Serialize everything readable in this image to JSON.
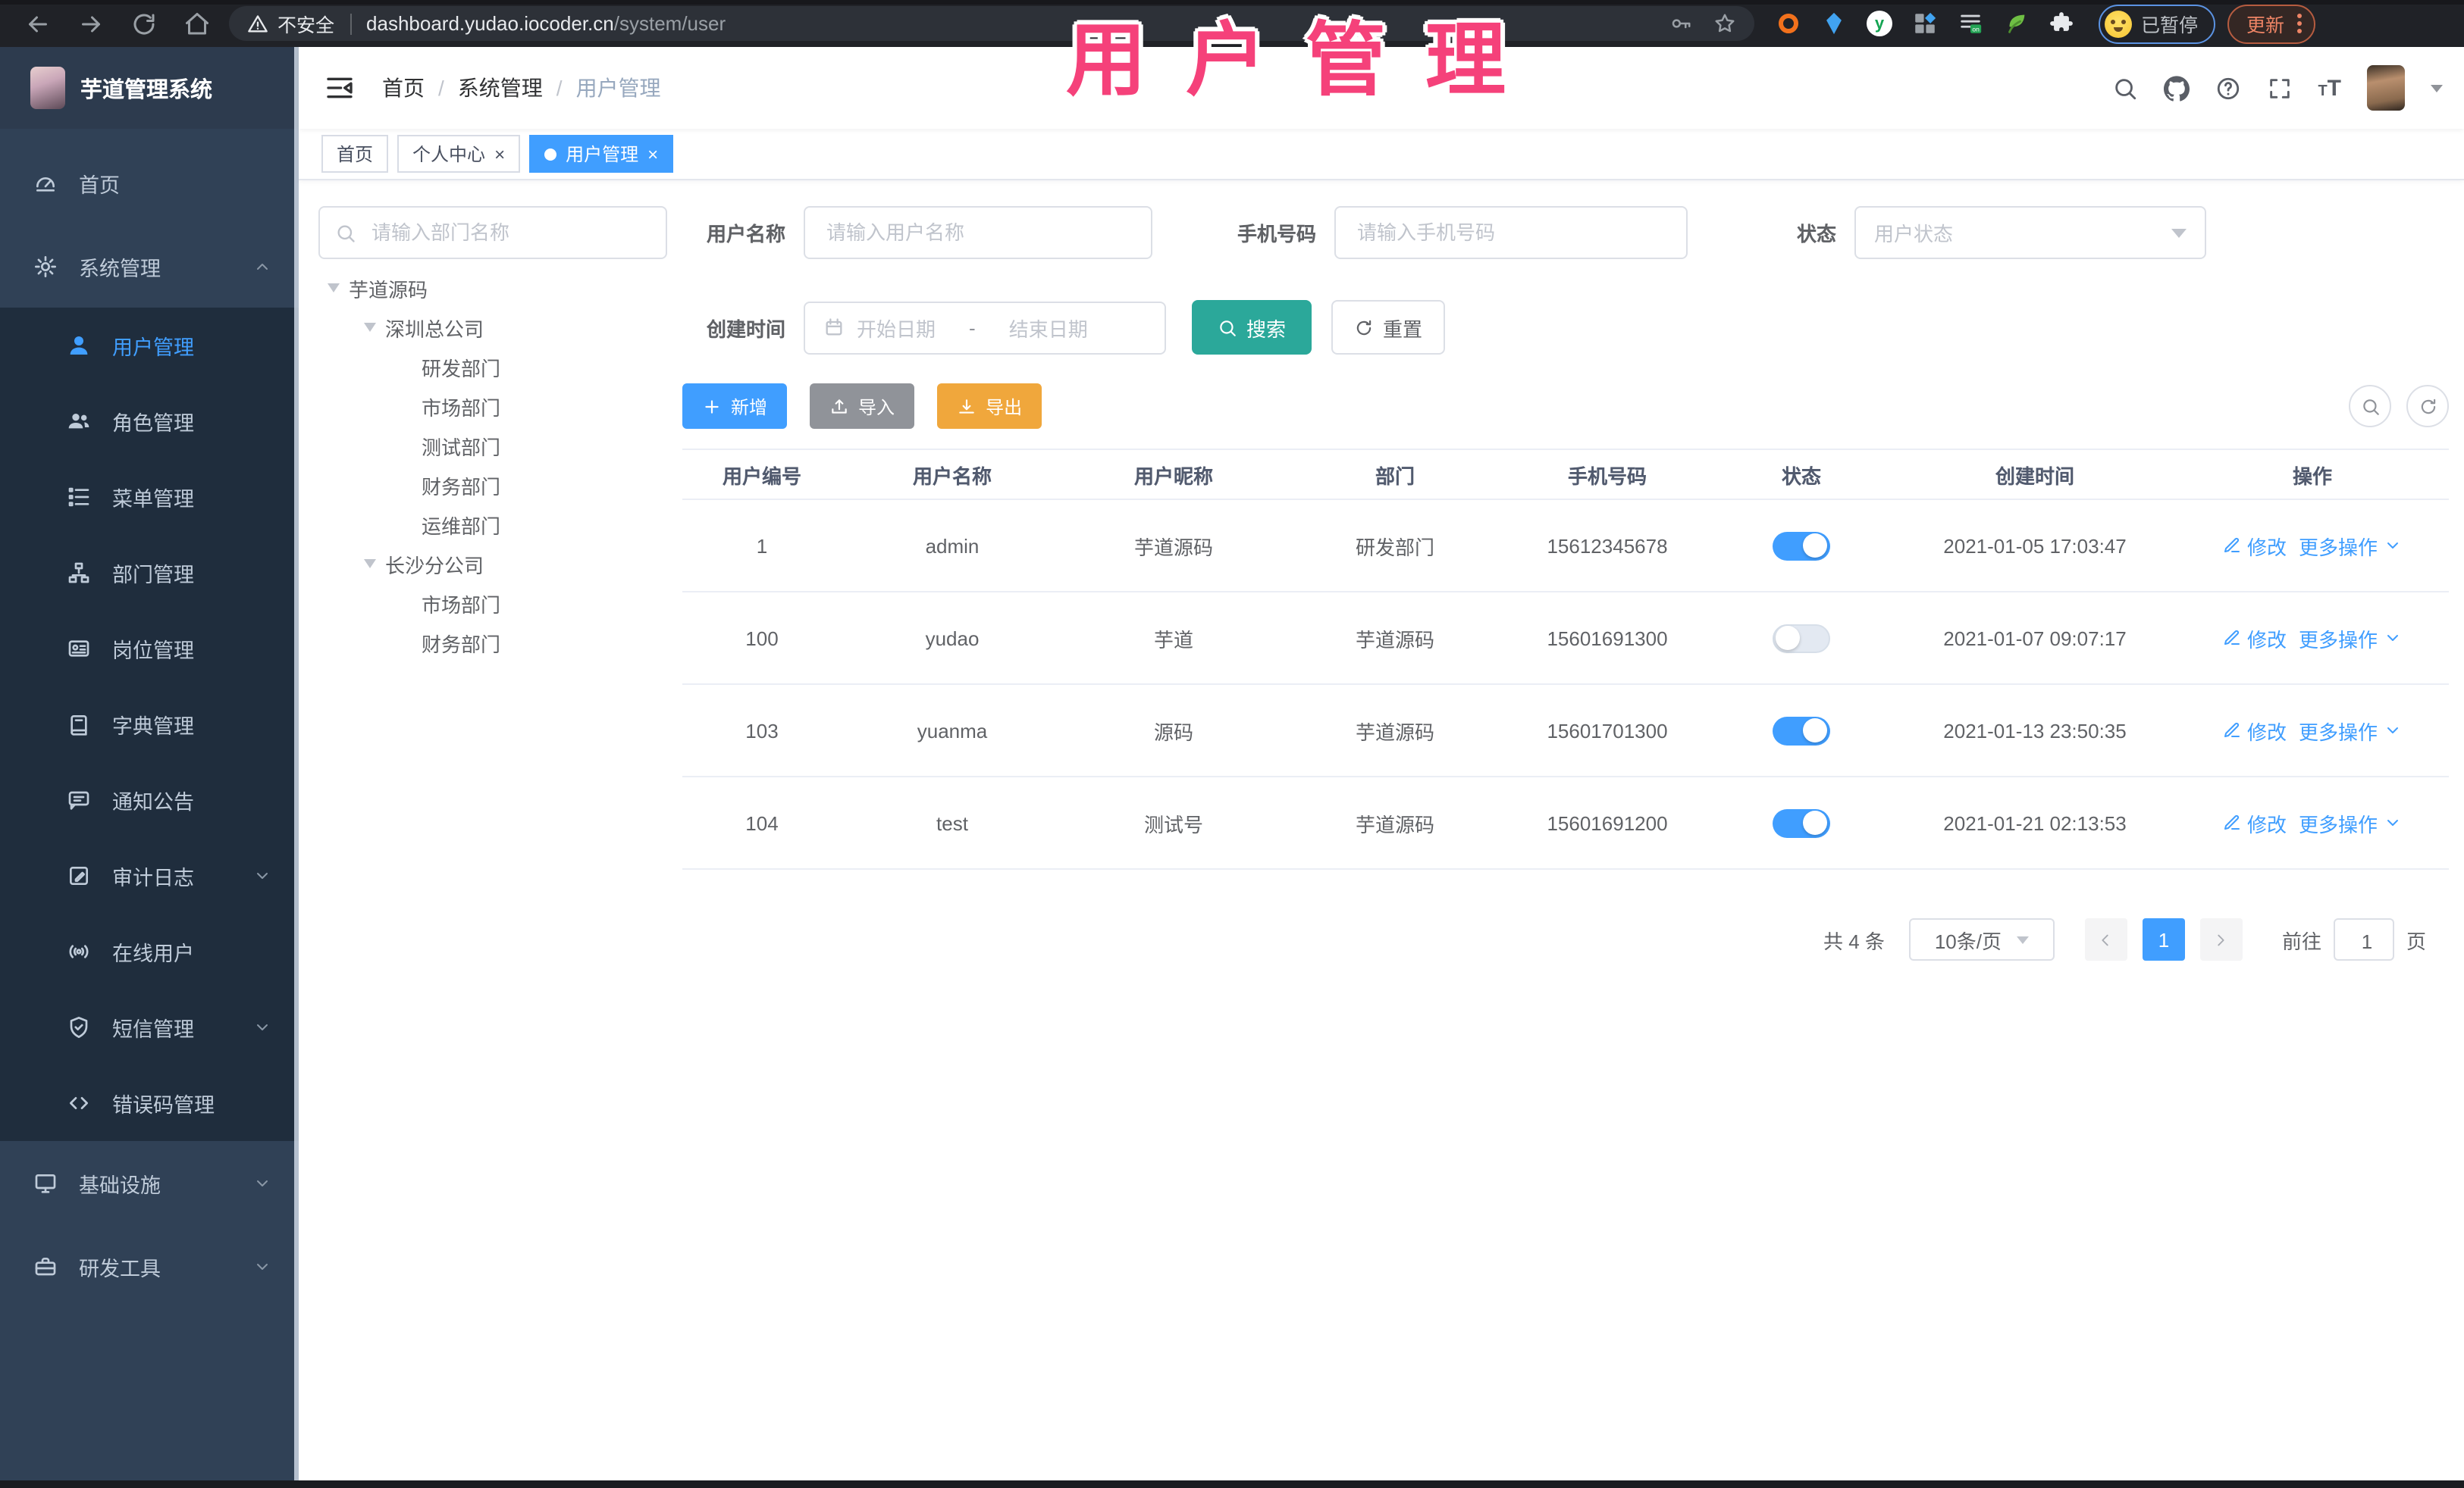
{
  "browser": {
    "security_label": "不安全",
    "url_domain": "dashboard.yudao.iocoder.cn",
    "url_path": "/system/user",
    "extension_icons": [
      "adblock-ring-icon",
      "gem-icon",
      "green-badge-icon",
      "grid-icon",
      "switch-on-icon",
      "leaf-icon",
      "puzzle-icon"
    ],
    "paused_label": "已暂停",
    "update_label": "更新"
  },
  "header": {
    "app_title": "芋道管理系统",
    "breadcrumb": [
      "首页",
      "系统管理",
      "用户管理"
    ],
    "breadcrumb_separator": "/"
  },
  "tabs": [
    {
      "label": "首页",
      "closable": false,
      "active": false
    },
    {
      "label": "个人中心",
      "closable": true,
      "active": false
    },
    {
      "label": "用户管理",
      "closable": true,
      "active": true
    }
  ],
  "annotation": {
    "text": "用户管理",
    "color": "#f5417a"
  },
  "sidebar": {
    "items": [
      {
        "label": "首页",
        "icon": "dashboard-icon",
        "level": "root"
      },
      {
        "label": "系统管理",
        "icon": "gear-icon",
        "level": "root",
        "chevron": "up"
      },
      {
        "label": "用户管理",
        "icon": "user-icon",
        "level": "sub",
        "active": true
      },
      {
        "label": "角色管理",
        "icon": "users-icon",
        "level": "sub"
      },
      {
        "label": "菜单管理",
        "icon": "menu-list-icon",
        "level": "sub"
      },
      {
        "label": "部门管理",
        "icon": "org-tree-icon",
        "level": "sub"
      },
      {
        "label": "岗位管理",
        "icon": "id-card-icon",
        "level": "sub"
      },
      {
        "label": "字典管理",
        "icon": "dictionary-icon",
        "level": "sub"
      },
      {
        "label": "通知公告",
        "icon": "announcement-icon",
        "level": "sub"
      },
      {
        "label": "审计日志",
        "icon": "audit-log-icon",
        "level": "sub",
        "chevron": "down"
      },
      {
        "label": "在线用户",
        "icon": "online-users-icon",
        "level": "sub"
      },
      {
        "label": "短信管理",
        "icon": "sms-icon",
        "level": "sub",
        "chevron": "down"
      },
      {
        "label": "错误码管理",
        "icon": "error-code-icon",
        "level": "sub"
      },
      {
        "label": "基础设施",
        "icon": "infrastructure-icon",
        "level": "root",
        "chevron": "down"
      },
      {
        "label": "研发工具",
        "icon": "dev-tools-icon",
        "level": "root",
        "chevron": "down"
      }
    ]
  },
  "dept_panel": {
    "search_placeholder": "请输入部门名称",
    "tree": [
      {
        "label": "芋道源码",
        "depth": 0,
        "expandable": true
      },
      {
        "label": "深圳总公司",
        "depth": 1,
        "expandable": true
      },
      {
        "label": "研发部门",
        "depth": 2,
        "expandable": false
      },
      {
        "label": "市场部门",
        "depth": 2,
        "expandable": false
      },
      {
        "label": "测试部门",
        "depth": 2,
        "expandable": false
      },
      {
        "label": "财务部门",
        "depth": 2,
        "expandable": false
      },
      {
        "label": "运维部门",
        "depth": 2,
        "expandable": false
      },
      {
        "label": "长沙分公司",
        "depth": 1,
        "expandable": true
      },
      {
        "label": "市场部门",
        "depth": 2,
        "expandable": false
      },
      {
        "label": "财务部门",
        "depth": 2,
        "expandable": false
      }
    ]
  },
  "filters": {
    "username_label": "用户名称",
    "username_placeholder": "请输入用户名称",
    "mobile_label": "手机号码",
    "mobile_placeholder": "请输入手机号码",
    "status_label": "状态",
    "status_placeholder": "用户状态",
    "create_time_label": "创建时间",
    "date_start_placeholder": "开始日期",
    "date_separator": "-",
    "date_end_placeholder": "结束日期",
    "search_label": "搜索",
    "reset_label": "重置"
  },
  "toolbar": {
    "add_label": "新增",
    "import_label": "导入",
    "export_label": "导出"
  },
  "table": {
    "headers": [
      "用户编号",
      "用户名称",
      "用户昵称",
      "部门",
      "手机号码",
      "状态",
      "创建时间",
      "操作"
    ],
    "edit_label": "修改",
    "more_label": "更多操作",
    "rows": [
      {
        "id": "1",
        "username": "admin",
        "nickname": "芋道源码",
        "dept": "研发部门",
        "mobile": "15612345678",
        "status_on": true,
        "created": "2021-01-05 17:03:47"
      },
      {
        "id": "100",
        "username": "yudao",
        "nickname": "芋道",
        "dept": "芋道源码",
        "mobile": "15601691300",
        "status_on": false,
        "created": "2021-01-07 09:07:17"
      },
      {
        "id": "103",
        "username": "yuanma",
        "nickname": "源码",
        "dept": "芋道源码",
        "mobile": "15601701300",
        "status_on": true,
        "created": "2021-01-13 23:50:35"
      },
      {
        "id": "104",
        "username": "test",
        "nickname": "测试号",
        "dept": "芋道源码",
        "mobile": "15601691200",
        "status_on": true,
        "created": "2021-01-21 02:13:53"
      }
    ]
  },
  "pagination": {
    "total_label": "共 4 条",
    "page_size_label": "10条/页",
    "current_page": "1",
    "goto_label": "前往",
    "goto_value": "1",
    "page_unit_label": "页"
  },
  "colors": {
    "accent": "#409eff",
    "sidebar_bg": "#304156",
    "sidebar_sub_bg": "#1f2d3d",
    "search_button": "#2ba89a",
    "import_button": "#909399",
    "export_button": "#f0a73c",
    "annotation": "#f5417a"
  }
}
